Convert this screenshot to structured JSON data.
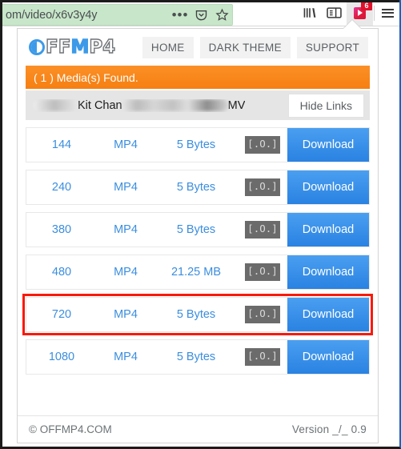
{
  "browser": {
    "url_text": "om/video/x6v3y4y",
    "icons": {
      "more": "ellipsis-icon",
      "pocket": "pocket-icon",
      "bookmark": "star-icon",
      "library": "library-icon",
      "sidebar": "sidebar-icon",
      "extension": "video-downloader-extension-icon",
      "menu": "hamburger-menu-icon"
    },
    "extension_badge": "6"
  },
  "popup": {
    "logo": {
      "mark": "O",
      "part1": "FF",
      "part2": "M",
      "part3": "P4",
      "full": "OFFMP4"
    },
    "nav": [
      {
        "label": "HOME",
        "name": "nav-home"
      },
      {
        "label": "DARK THEME",
        "name": "nav-dark-theme"
      },
      {
        "label": "SUPPORT",
        "name": "nav-support"
      }
    ],
    "banner": "( 1 ) Media(s) Found.",
    "title": {
      "text_visible_1": "Kit Chan",
      "text_visible_2": "MV",
      "redacted_1": "",
      "redacted_2": ""
    },
    "hide_links_label": "Hide Links",
    "table": {
      "rows": [
        {
          "resolution": "144",
          "format": "MP4",
          "size": "5 Bytes",
          "icon": "film-icon",
          "action": "Download",
          "highlighted": false
        },
        {
          "resolution": "240",
          "format": "MP4",
          "size": "5 Bytes",
          "icon": "film-icon",
          "action": "Download",
          "highlighted": false
        },
        {
          "resolution": "380",
          "format": "MP4",
          "size": "5 Bytes",
          "icon": "film-icon",
          "action": "Download",
          "highlighted": false
        },
        {
          "resolution": "480",
          "format": "MP4",
          "size": "21.25 MB",
          "icon": "film-icon",
          "action": "Download",
          "highlighted": false
        },
        {
          "resolution": "720",
          "format": "MP4",
          "size": "5 Bytes",
          "icon": "film-icon",
          "action": "Download",
          "highlighted": true
        },
        {
          "resolution": "1080",
          "format": "MP4",
          "size": "5 Bytes",
          "icon": "film-icon",
          "action": "Download",
          "highlighted": false
        }
      ],
      "icon_glyph": "[.O.]"
    },
    "footer": {
      "copyright": "© OFFMP4.COM",
      "version": "Version _/_ 0.9"
    }
  },
  "colors": {
    "banner_orange": "#f67f12",
    "download_blue": "#2a82e2",
    "link_blue": "#3b8ede",
    "highlight_red": "#fa1909",
    "url_green": "#c8e6c9",
    "badge_red": "#e0112b"
  }
}
